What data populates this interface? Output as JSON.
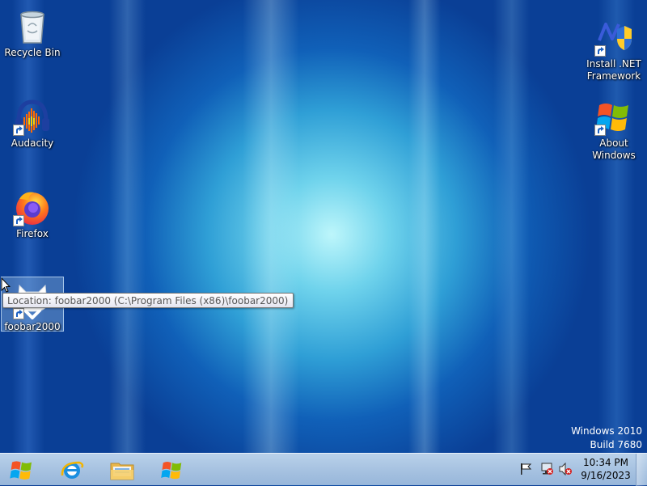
{
  "desktop": {
    "icons": [
      {
        "label": "Recycle Bin",
        "icon": "recycle-bin-icon",
        "shortcut": false
      },
      {
        "label": "Audacity",
        "icon": "audacity-icon",
        "shortcut": true
      },
      {
        "label": "Firefox",
        "icon": "firefox-icon",
        "shortcut": true
      },
      {
        "label": "foobar2000",
        "icon": "foobar2000-icon",
        "shortcut": true,
        "selected": true
      },
      {
        "label": "Install .NET Framework",
        "icon": "dotnet-installer-icon",
        "shortcut": true
      },
      {
        "label": "About Windows",
        "icon": "windows-flag-icon",
        "shortcut": true
      }
    ],
    "tooltip": "Location: foobar2000 (C:\\Program Files (x86)\\foobar2000)",
    "watermark": {
      "line1": "Windows 2010",
      "line2": "Build 7680"
    }
  },
  "taskbar": {
    "pinned": [
      {
        "name": "start-button",
        "icon": "windows-flag-icon"
      },
      {
        "name": "internet-explorer",
        "icon": "internet-explorer-icon"
      },
      {
        "name": "windows-explorer",
        "icon": "folder-icon"
      },
      {
        "name": "about-windows",
        "icon": "windows-flag-icon"
      }
    ],
    "tray_icons": [
      "action-center-flag-icon",
      "network-disconnected-icon",
      "volume-muted-icon"
    ],
    "clock": {
      "time": "10:34 PM",
      "date": "9/16/2023"
    }
  },
  "colors": {
    "taskbar": "#a9c4e2",
    "desktop_center": "#bdf6fb",
    "desktop_edge": "#0a3f96"
  }
}
